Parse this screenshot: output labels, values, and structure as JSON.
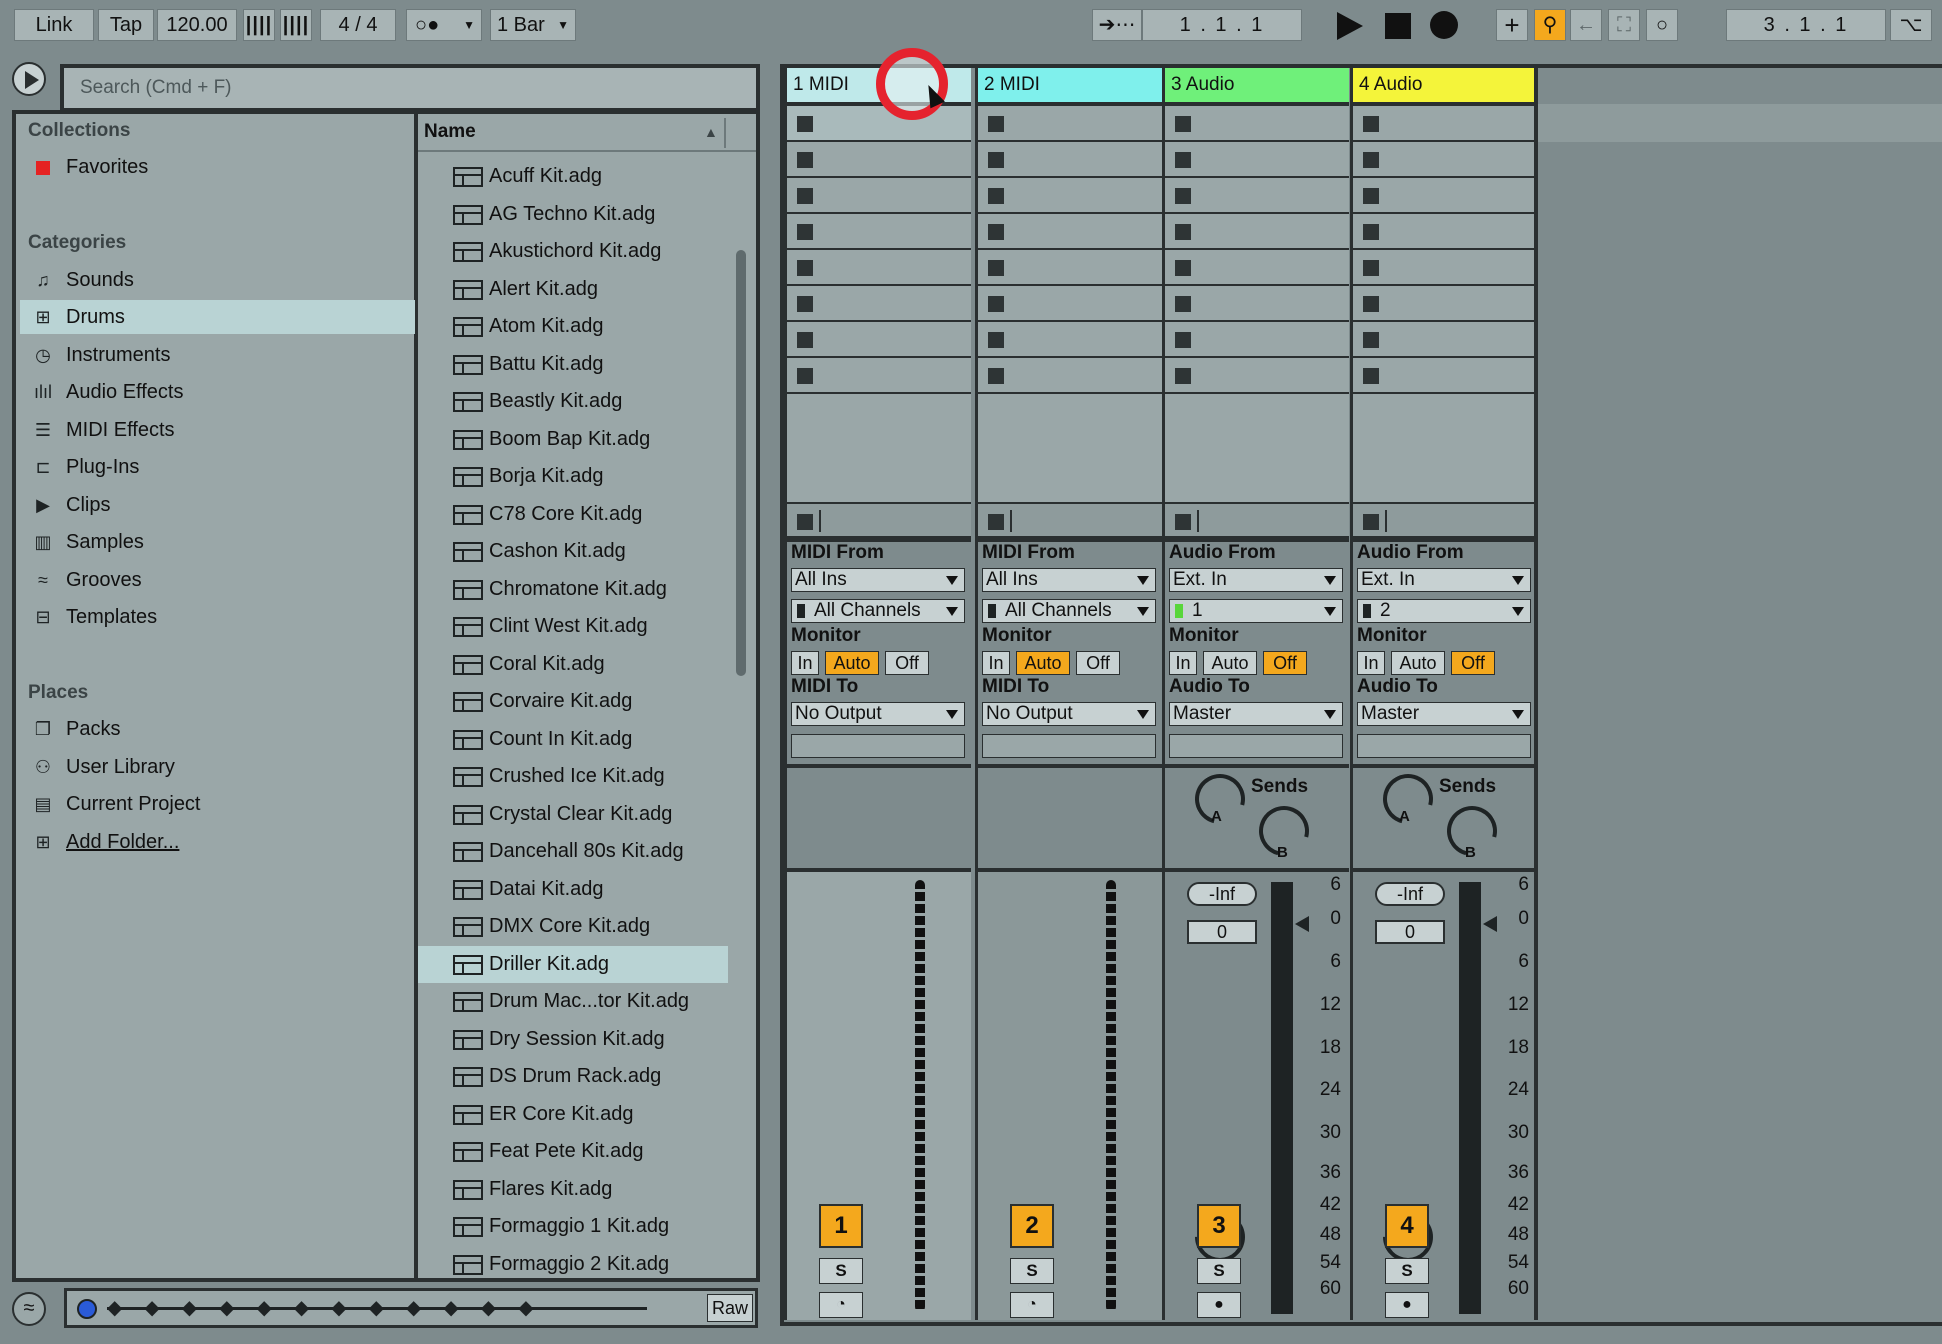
{
  "toolbar": {
    "link": "Link",
    "tap": "Tap",
    "tempo": "120.00",
    "time_signature": "4 / 4",
    "quantize": "1 Bar",
    "arrangement_position": "1 .   1 .   1",
    "loop_position": "3 .   1 .   1"
  },
  "browser": {
    "search_placeholder": "Search (Cmd + F)",
    "collections_heading": "Collections",
    "favorites": "Favorites",
    "categories_heading": "Categories",
    "categories": [
      "Sounds",
      "Drums",
      "Instruments",
      "Audio Effects",
      "MIDI Effects",
      "Plug-Ins",
      "Clips",
      "Samples",
      "Grooves",
      "Templates"
    ],
    "places_heading": "Places",
    "places": [
      "Packs",
      "User Library",
      "Current Project",
      "Add Folder..."
    ],
    "list_header": "Name",
    "files": [
      "Acuff Kit.adg",
      "AG Techno Kit.adg",
      "Akustichord Kit.adg",
      "Alert Kit.adg",
      "Atom Kit.adg",
      "Battu Kit.adg",
      "Beastly Kit.adg",
      "Boom Bap Kit.adg",
      "Borja Kit.adg",
      "C78 Core Kit.adg",
      "Cashon Kit.adg",
      "Chromatone Kit.adg",
      "Clint West Kit.adg",
      "Coral Kit.adg",
      "Corvaire Kit.adg",
      "Count In Kit.adg",
      "Crushed Ice Kit.adg",
      "Crystal Clear Kit.adg",
      "Dancehall 80s Kit.adg",
      "Datai Kit.adg",
      "DMX Core Kit.adg",
      "Driller Kit.adg",
      "Drum Mac...tor Kit.adg",
      "Dry Session Kit.adg",
      "DS Drum Rack.adg",
      "ER Core Kit.adg",
      "Feat Pete Kit.adg",
      "Flares Kit.adg",
      "Formaggio 1 Kit.adg",
      "Formaggio 2 Kit.adg"
    ],
    "selected_file": "Driller Kit.adg",
    "selected_category": "Drums",
    "raw_button": "Raw"
  },
  "tracks": [
    {
      "name": "1 MIDI",
      "color": "#bfe9ea",
      "from_label": "MIDI From",
      "from": "All Ins",
      "channel": "All Channels",
      "monitor_label": "Monitor",
      "monitor": [
        "In",
        "Auto",
        "Off"
      ],
      "monitor_active": "Auto",
      "to_label": "MIDI To",
      "to": "No Output",
      "number": "1",
      "solo": "S"
    },
    {
      "name": "2 MIDI",
      "color": "#7ff0ec",
      "from_label": "MIDI From",
      "from": "All Ins",
      "channel": "All Channels",
      "monitor_label": "Monitor",
      "monitor": [
        "In",
        "Auto",
        "Off"
      ],
      "monitor_active": "Auto",
      "to_label": "MIDI To",
      "to": "No Output",
      "number": "2",
      "solo": "S"
    },
    {
      "name": "3 Audio",
      "color": "#6ff07a",
      "from_label": "Audio From",
      "from": "Ext. In",
      "channel": "1",
      "monitor_label": "Monitor",
      "monitor": [
        "In",
        "Auto",
        "Off"
      ],
      "monitor_active": "Off",
      "to_label": "Audio To",
      "to": "Master",
      "number": "3",
      "solo": "S",
      "sends": "Sends",
      "volume": "-Inf",
      "pan": "0"
    },
    {
      "name": "4 Audio",
      "color": "#f4f43a",
      "from_label": "Audio From",
      "from": "Ext. In",
      "channel": "2",
      "monitor_label": "Monitor",
      "monitor": [
        "In",
        "Auto",
        "Off"
      ],
      "monitor_active": "Off",
      "to_label": "Audio To",
      "to": "Master",
      "number": "4",
      "solo": "S",
      "sends": "Sends",
      "volume": "-Inf",
      "pan": "0"
    }
  ],
  "meter_scale": [
    "6",
    "0",
    "6",
    "12",
    "18",
    "24",
    "30",
    "36",
    "42",
    "48",
    "54",
    "60"
  ],
  "send_labels": [
    "A",
    "B"
  ],
  "accent_color": "#f4a81d"
}
